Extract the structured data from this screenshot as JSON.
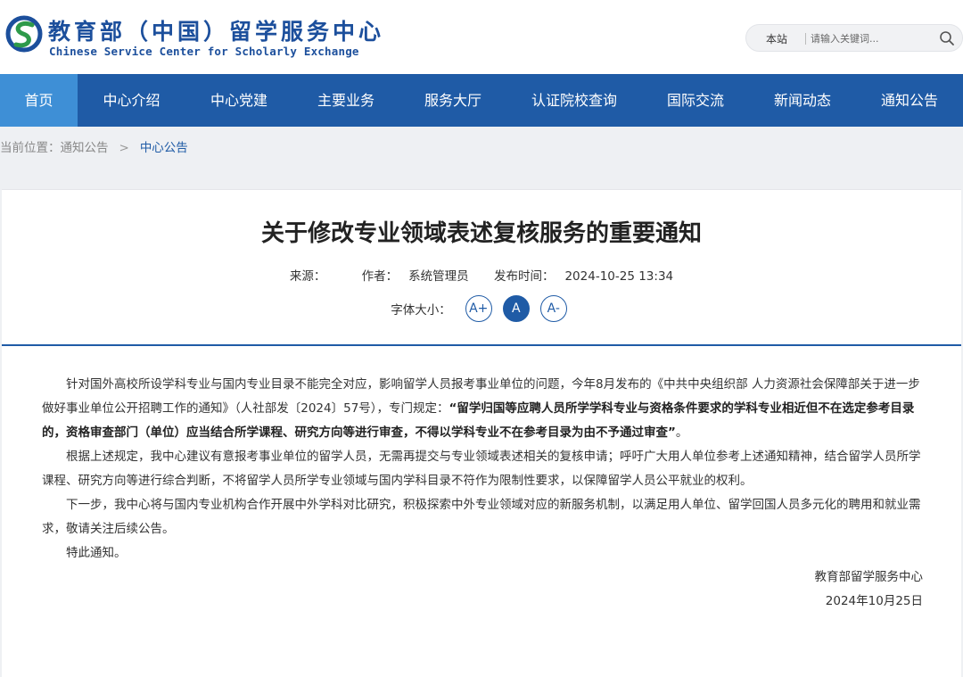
{
  "header": {
    "logo_cn": "教育部（中国）留学服务中心",
    "logo_en": "Chinese Service Center for Scholarly Exchange",
    "search": {
      "scope": "本站",
      "placeholder": "请输入关键词..."
    }
  },
  "colors": {
    "nav_bg": "#1f5ba6",
    "nav_active": "#3e8fd6",
    "accent": "#1f5ba6"
  },
  "nav": {
    "items": [
      {
        "label": "首页",
        "active": true
      },
      {
        "label": "中心介绍"
      },
      {
        "label": "中心党建"
      },
      {
        "label": "主要业务"
      },
      {
        "label": "服务大厅"
      },
      {
        "label": "认证院校查询"
      },
      {
        "label": "国际交流"
      },
      {
        "label": "新闻动态"
      },
      {
        "label": "通知公告"
      }
    ]
  },
  "breadcrumb": {
    "prefix": "当前位置：",
    "parent": "通知公告",
    "separator": ">",
    "current": "中心公告"
  },
  "article": {
    "title": "关于修改专业领域表述复核服务的重要通知",
    "source_label": "来源：",
    "source": "",
    "author_label": "作者：",
    "author": "系统管理员",
    "date_label": "发布时间：",
    "date": "2024-10-25 13:34",
    "font_size_label": "字体大小：",
    "font_buttons": [
      "A+",
      "A",
      "A-"
    ],
    "p1_normal": "针对国外高校所设学科专业与国内专业目录不能完全对应，影响留学人员报考事业单位的问题，今年8月发布的《中共中央组织部 人力资源社会保障部关于进一步做好事业单位公开招聘工作的通知》（人社部发〔2024〕57号），专门规定：",
    "p1_bold": "“留学归国等应聘人员所学学科专业与资格条件要求的学科专业相近但不在选定参考目录的，资格审查部门（单位）应当结合所学课程、研究方向等进行审查，不得以学科专业不在参考目录为由不予通过审查”",
    "p1_end": "。",
    "p2": "根据上述规定，我中心建议有意报考事业单位的留学人员，无需再提交与专业领域表述相关的复核申请；呼吁广大用人单位参考上述通知精神，结合留学人员所学课程、研究方向等进行综合判断，不将留学人员所学专业领域与国内学科目录不符作为限制性要求，以保障留学人员公平就业的权利。",
    "p3": "下一步，我中心将与国内专业机构合作开展中外学科对比研究，积极探索中外专业领域对应的新服务机制，以满足用人单位、留学回国人员多元化的聘用和就业需求，敬请关注后续公告。",
    "p4": "特此通知。",
    "signature": "教育部留学服务中心",
    "sign_date": "2024年10月25日"
  }
}
